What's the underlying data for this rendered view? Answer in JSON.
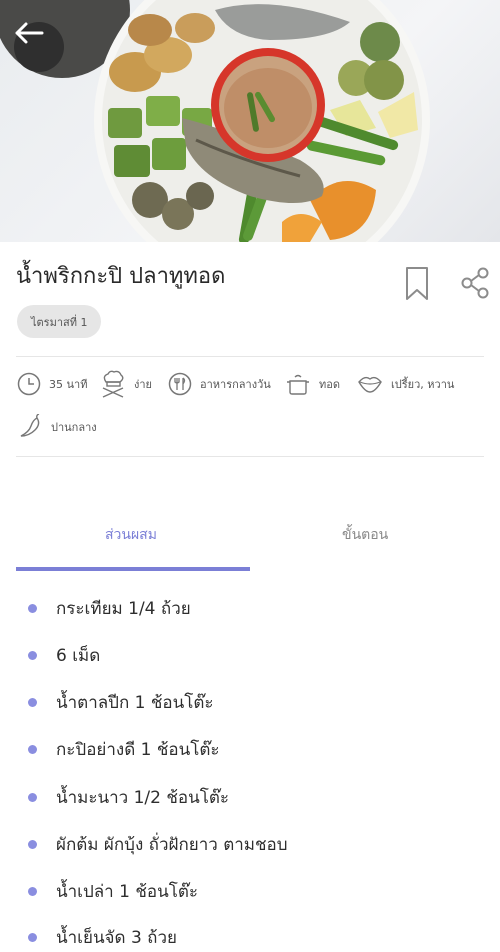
{
  "recipe": {
    "title": "น้ำพริกกะปิ ปลาทูทอด",
    "tag": "ไตรมาสที่ 1"
  },
  "meta": {
    "time": "35 นาที",
    "difficulty": "ง่าย",
    "meal": "อาหารกลางวัน",
    "method": "ทอด",
    "taste": "เปรี้ยว, หวาน",
    "spice": "ปานกลาง"
  },
  "tabs": {
    "ingredients": "ส่วนผสม",
    "steps": "ขั้นตอน"
  },
  "ingredients": [
    "กระเทียม 1/4 ถ้วย",
    "6 เม็ด",
    "น้ำตาลปีก 1 ช้อนโต๊ะ",
    "กะปิอย่างดี 1 ช้อนโต๊ะ",
    "น้ำมะนาว 1/2 ช้อนโต๊ะ",
    "ผักต้ม ผักบุ้ง ถั่วฝักยาว ตามชอบ",
    "น้ำเปล่า 1 ช้อนโต๊ะ",
    "น้ำเย็นจัด 3 ถ้วย"
  ],
  "colors": {
    "accent": "#7b7fd6",
    "bullet": "#8a8ee0",
    "chip_bg": "#e6e6e6"
  },
  "icons": {
    "back": "arrow-left-icon",
    "bookmark": "bookmark-icon",
    "share": "share-icon"
  }
}
